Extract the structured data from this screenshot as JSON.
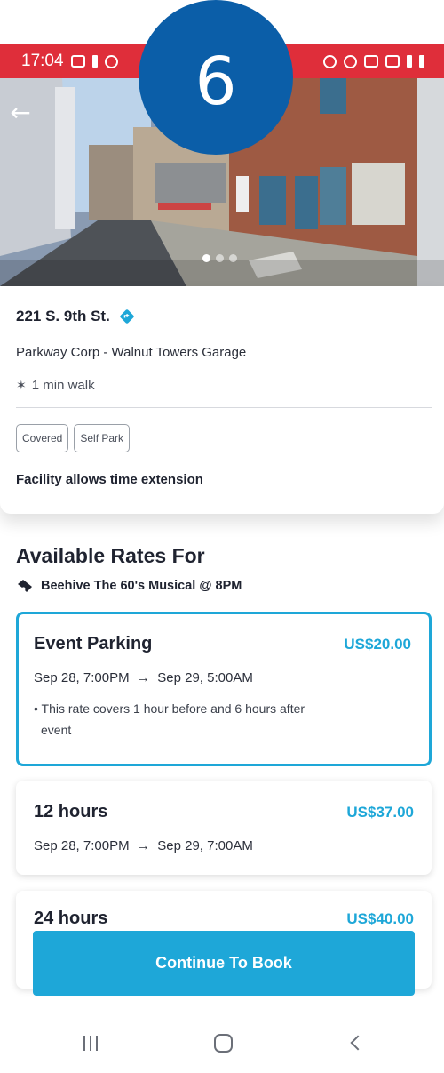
{
  "status_bar": {
    "time": "17:04"
  },
  "step_badge": "6",
  "photo": {
    "slide_count": 3,
    "active_slide": 1
  },
  "location": {
    "address": "221 S. 9th St.",
    "operator": "Parkway Corp - Walnut Towers Garage",
    "walk_time": "1 min walk",
    "tags": [
      "Covered",
      "Self Park"
    ],
    "extension_note": "Facility allows time extension"
  },
  "rates_section": {
    "title": "Available Rates For",
    "event": "Beehive The 60's Musical @ 8PM"
  },
  "rates": [
    {
      "name": "Event Parking",
      "price": "US$20.00",
      "start": "Sep 28, 7:00PM",
      "arrow": "→",
      "end": "Sep 29, 5:00AM",
      "note_line1": "• This rate covers 1 hour before and 6 hours after",
      "note_line2": "event"
    },
    {
      "name": "12 hours",
      "price": "US$37.00",
      "start": "Sep 28, 7:00PM",
      "arrow": "→",
      "end": "Sep 29, 7:00AM"
    },
    {
      "name": "24 hours",
      "price": "US$40.00"
    }
  ],
  "cta": {
    "label": "Continue To Book"
  },
  "colors": {
    "accent": "#1ea7d8",
    "status_bar": "#df2e3a",
    "badge": "#0b5ea8"
  },
  "icons": {
    "back": "arrow-left-icon",
    "pin": "directions-pin-icon",
    "walk": "walking-icon",
    "ticket": "ticket-icon",
    "nav_recent": "recent-apps-icon",
    "nav_home": "home-icon",
    "nav_back": "back-chevron-icon"
  }
}
